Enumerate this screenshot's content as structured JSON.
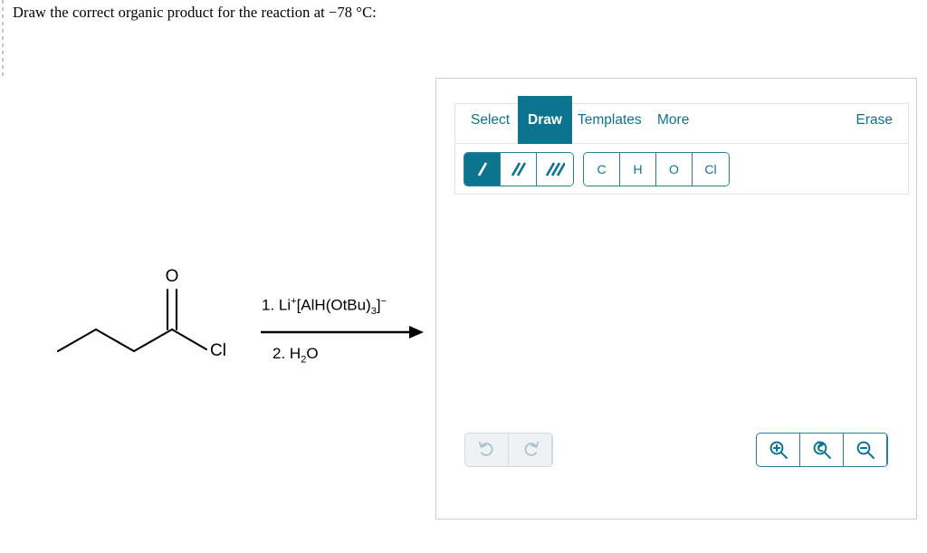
{
  "prompt": "Draw the correct organic product for the reaction at −78 °C:",
  "reaction": {
    "reactant_name": "butanoyl chloride",
    "reactant_labels": {
      "carbonyl_oxygen": "O",
      "chlorine": "Cl"
    },
    "reagent_line_1": "1. Li",
    "reagent_1_charge": "+",
    "reagent_1_body": "[AlH(OtBu)",
    "reagent_1_sub": "3",
    "reagent_1_tail": "]",
    "reagent_1_minus": "−",
    "reagent_line_2_pre": "2. H",
    "reagent_line_2_sub": "2",
    "reagent_line_2_post": "O",
    "arrow": "reaction-arrow-right"
  },
  "editor": {
    "tabs": [
      {
        "id": "select",
        "label": "Select",
        "active": false
      },
      {
        "id": "draw",
        "label": "Draw",
        "active": true
      },
      {
        "id": "templates",
        "label": "Templates",
        "active": false
      },
      {
        "id": "more",
        "label": "More",
        "active": false
      }
    ],
    "erase_label": "Erase",
    "bond_tools": [
      {
        "id": "single-bond",
        "icon": "single-bond-icon",
        "strokes": 1,
        "active": true
      },
      {
        "id": "double-bond",
        "icon": "double-bond-icon",
        "strokes": 2,
        "active": false
      },
      {
        "id": "triple-bond",
        "icon": "triple-bond-icon",
        "strokes": 3,
        "active": false
      }
    ],
    "element_tools": [
      {
        "id": "carbon",
        "label": "C"
      },
      {
        "id": "hydrogen",
        "label": "H"
      },
      {
        "id": "oxygen",
        "label": "O"
      },
      {
        "id": "chlorine",
        "label": "Cl"
      }
    ],
    "history_controls": [
      {
        "id": "undo",
        "icon": "undo-icon",
        "enabled": false
      },
      {
        "id": "redo",
        "icon": "redo-icon",
        "enabled": false
      }
    ],
    "zoom_controls": [
      {
        "id": "zoom-in",
        "icon": "zoom-in-icon",
        "enabled": true
      },
      {
        "id": "zoom-reset",
        "icon": "zoom-reset-icon",
        "enabled": true
      },
      {
        "id": "zoom-out",
        "icon": "zoom-out-icon",
        "enabled": true
      }
    ],
    "canvas_empty": true
  },
  "colors": {
    "accent_teal": "#0d7490",
    "accent_teal_text": "#11738c",
    "border_grey": "#cfcfcf",
    "disabled_grey": "#aac3cd",
    "disabled_bg": "#eef2f4"
  }
}
